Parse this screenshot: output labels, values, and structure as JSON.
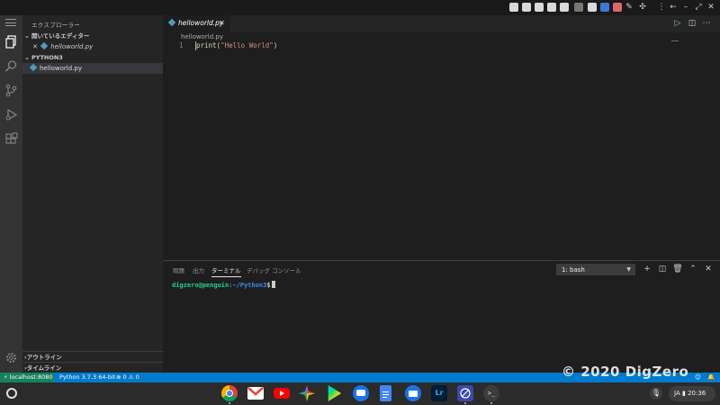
{
  "sidebar": {
    "title": "エクスプローラー",
    "open_editors_label": "開いているエディター",
    "open_editor_file": "helloworld.py",
    "folder_label": "PYTHON3",
    "file": "helloworld.py",
    "outline_label": "アウトライン",
    "timeline_label": "タイムライン"
  },
  "editor": {
    "tab_label": "helloworld.py",
    "breadcrumb": "helloworld.py",
    "line_number": "1",
    "code_func": "print",
    "code_open": "(",
    "code_string": "\"Hello World\"",
    "code_close": ")"
  },
  "panel": {
    "tabs": [
      "問題",
      "出力",
      "ターミナル",
      "デバッグ コンソール"
    ],
    "active_tab": "ターミナル",
    "terminal_select": "1: bash",
    "prompt_user": "digzero@penguin",
    "prompt_path": ":~/Python3",
    "prompt_symbol": "$"
  },
  "statusbar": {
    "remote": "localhost:8080",
    "interpreter": "Python 3.7.3 64-bit",
    "errors": "0",
    "warnings": "0"
  },
  "watermark": "© 2020 DigZero",
  "shelf": {
    "language": "JA",
    "time": "20:36",
    "apps": [
      "chrome-icon",
      "gmail-icon",
      "youtube-icon",
      "photos-icon",
      "play-store-icon",
      "messages-icon",
      "docs-icon",
      "files-icon",
      "lightroom-icon",
      "linux-app-icon",
      "terminal-icon"
    ]
  },
  "colors": {
    "accent": "#007acc",
    "remote": "#16825d",
    "string": "#ce9178",
    "function": "#dcdcaa",
    "prompt_user": "#23d18b",
    "prompt_path": "#3b8eea"
  }
}
